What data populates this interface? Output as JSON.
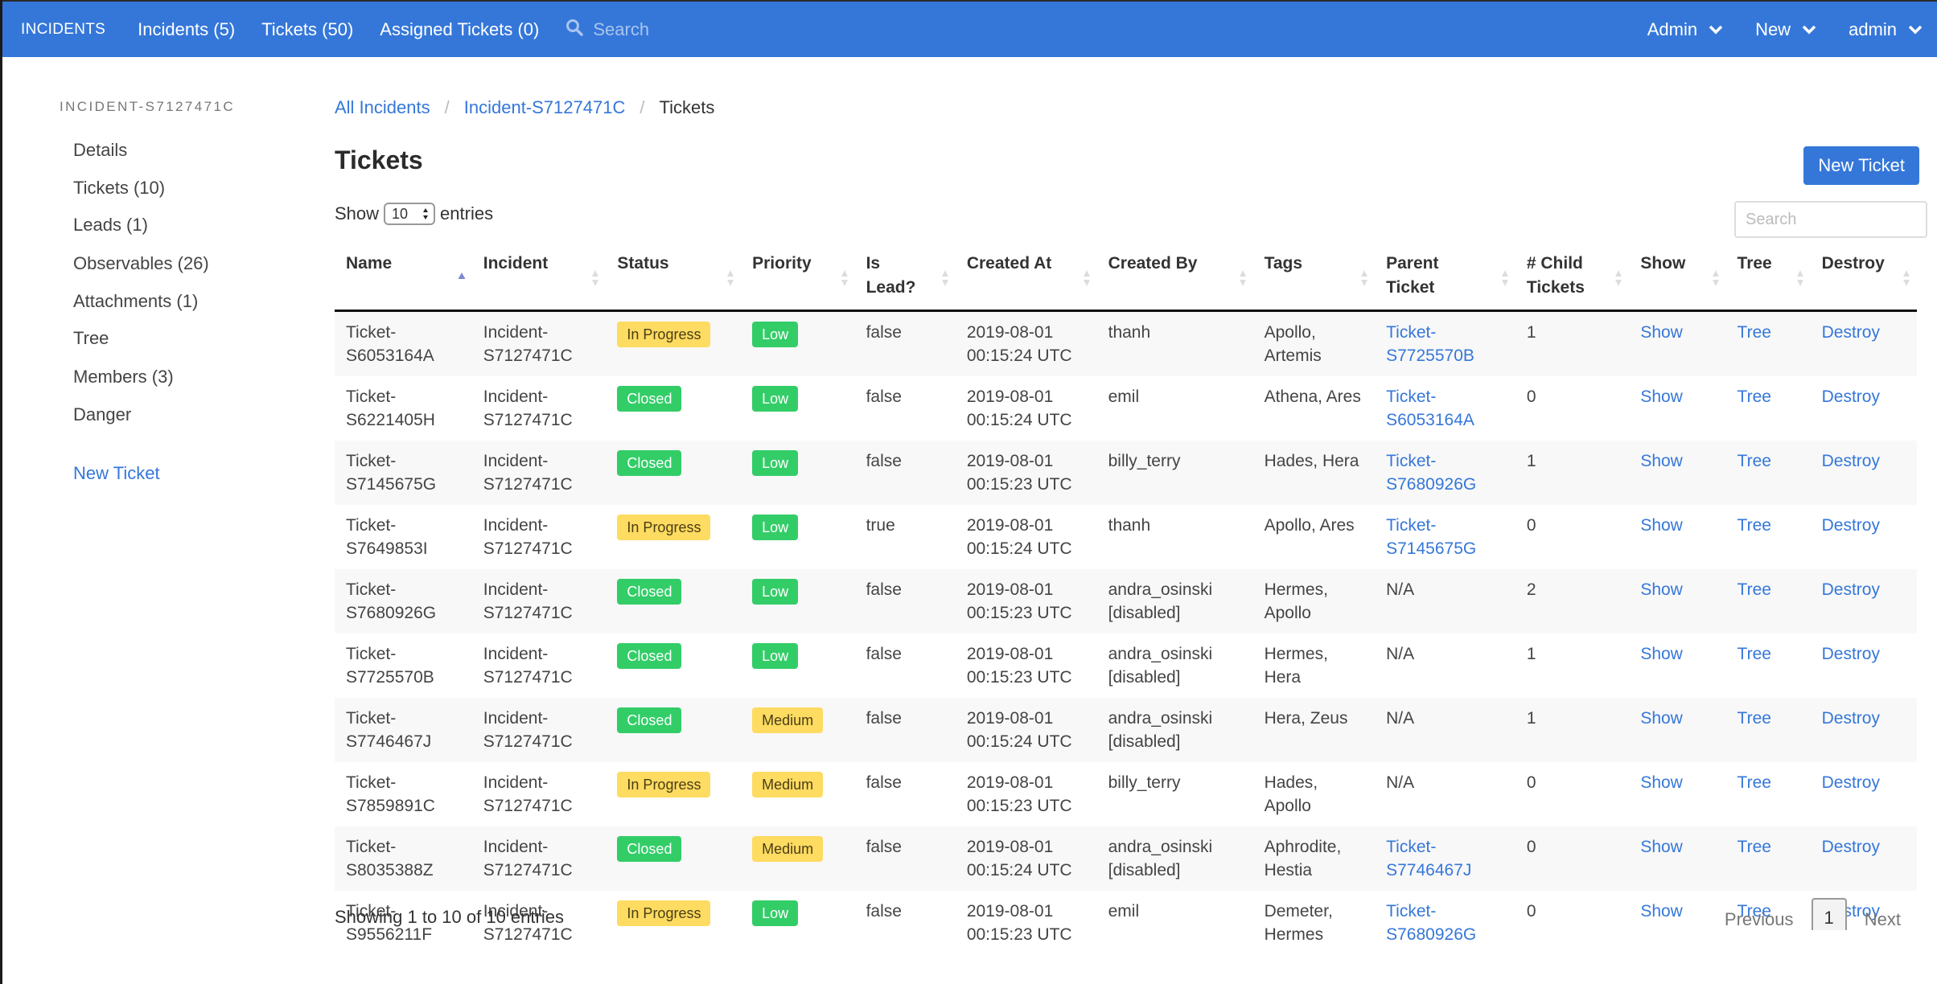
{
  "navbar": {
    "brand": "INCIDENTS",
    "links": [
      "Incidents (5)",
      "Tickets (50)",
      "Assigned Tickets (0)"
    ],
    "search_placeholder": "Search",
    "search_icon": "search-icon",
    "dropdowns": [
      "Admin",
      "New",
      "admin"
    ],
    "dropdown_icon": "chevron-down-icon",
    "color": "#3577d9"
  },
  "sidebar": {
    "heading": "INCIDENT-S7127471C",
    "items": [
      "Details",
      "Tickets (10)",
      "Leads (1)",
      "Observables (26)",
      "Attachments (1)",
      "Tree",
      "Members (3)",
      "Danger"
    ],
    "new_ticket_link": "New Ticket"
  },
  "breadcrumb": {
    "items": [
      "All Incidents",
      "Incident-S7127471C"
    ],
    "current": "Tickets",
    "separator": "/"
  },
  "page": {
    "title": "Tickets",
    "new_ticket_button": "New Ticket",
    "show_label": "Show",
    "entries_label": "entries",
    "page_length": "10",
    "search_placeholder": "Search"
  },
  "table": {
    "columns": [
      {
        "label": "Name",
        "sort": "asc"
      },
      {
        "label": "Incident",
        "sort": "none"
      },
      {
        "label": "Status",
        "sort": "none"
      },
      {
        "label": "Priority",
        "sort": "none"
      },
      {
        "label": "Is Lead?",
        "sort": "none"
      },
      {
        "label": "Created At",
        "sort": "none"
      },
      {
        "label": "Created By",
        "sort": "none"
      },
      {
        "label": "Tags",
        "sort": "none"
      },
      {
        "label": "Parent Ticket",
        "sort": "none"
      },
      {
        "label": "# Child Tickets",
        "sort": "none"
      },
      {
        "label": "Show",
        "sort": "none"
      },
      {
        "label": "Tree",
        "sort": "none"
      },
      {
        "label": "Destroy",
        "sort": "none"
      }
    ],
    "status_colors": {
      "In Progress": "#fedb61",
      "Closed": "#33cd68"
    },
    "priority_colors": {
      "Low": "#33cd68",
      "Medium": "#fedb61"
    },
    "rows": [
      {
        "name": "Ticket-S6053164A",
        "incident": "Incident-S7127471C",
        "status": "In Progress",
        "priority": "Low",
        "is_lead": "false",
        "created_at": "2019-08-01 00:15:24 UTC",
        "created_by": "thanh",
        "tags": "Apollo, Artemis",
        "parent": "Ticket-S7725570B",
        "children": "1",
        "show": "Show",
        "tree": "Tree",
        "destroy": "Destroy"
      },
      {
        "name": "Ticket-S6221405H",
        "incident": "Incident-S7127471C",
        "status": "Closed",
        "priority": "Low",
        "is_lead": "false",
        "created_at": "2019-08-01 00:15:24 UTC",
        "created_by": "emil",
        "tags": "Athena, Ares",
        "parent": "Ticket-S6053164A",
        "children": "0",
        "show": "Show",
        "tree": "Tree",
        "destroy": "Destroy"
      },
      {
        "name": "Ticket-S7145675G",
        "incident": "Incident-S7127471C",
        "status": "Closed",
        "priority": "Low",
        "is_lead": "false",
        "created_at": "2019-08-01 00:15:23 UTC",
        "created_by": "billy_terry",
        "tags": "Hades, Hera",
        "parent": "Ticket-S7680926G",
        "children": "1",
        "show": "Show",
        "tree": "Tree",
        "destroy": "Destroy"
      },
      {
        "name": "Ticket-S7649853I",
        "incident": "Incident-S7127471C",
        "status": "In Progress",
        "priority": "Low",
        "is_lead": "true",
        "created_at": "2019-08-01 00:15:24 UTC",
        "created_by": "thanh",
        "tags": "Apollo, Ares",
        "parent": "Ticket-S7145675G",
        "children": "0",
        "show": "Show",
        "tree": "Tree",
        "destroy": "Destroy"
      },
      {
        "name": "Ticket-S7680926G",
        "incident": "Incident-S7127471C",
        "status": "Closed",
        "priority": "Low",
        "is_lead": "false",
        "created_at": "2019-08-01 00:15:23 UTC",
        "created_by": "andra_osinski [disabled]",
        "tags": "Hermes, Apollo",
        "parent": "N/A",
        "children": "2",
        "show": "Show",
        "tree": "Tree",
        "destroy": "Destroy"
      },
      {
        "name": "Ticket-S7725570B",
        "incident": "Incident-S7127471C",
        "status": "Closed",
        "priority": "Low",
        "is_lead": "false",
        "created_at": "2019-08-01 00:15:23 UTC",
        "created_by": "andra_osinski [disabled]",
        "tags": "Hermes, Hera",
        "parent": "N/A",
        "children": "1",
        "show": "Show",
        "tree": "Tree",
        "destroy": "Destroy"
      },
      {
        "name": "Ticket-S7746467J",
        "incident": "Incident-S7127471C",
        "status": "Closed",
        "priority": "Medium",
        "is_lead": "false",
        "created_at": "2019-08-01 00:15:24 UTC",
        "created_by": "andra_osinski [disabled]",
        "tags": "Hera, Zeus",
        "parent": "N/A",
        "children": "1",
        "show": "Show",
        "tree": "Tree",
        "destroy": "Destroy"
      },
      {
        "name": "Ticket-S7859891C",
        "incident": "Incident-S7127471C",
        "status": "In Progress",
        "priority": "Medium",
        "is_lead": "false",
        "created_at": "2019-08-01 00:15:23 UTC",
        "created_by": "billy_terry",
        "tags": "Hades, Apollo",
        "parent": "N/A",
        "children": "0",
        "show": "Show",
        "tree": "Tree",
        "destroy": "Destroy"
      },
      {
        "name": "Ticket-S8035388Z",
        "incident": "Incident-S7127471C",
        "status": "Closed",
        "priority": "Medium",
        "is_lead": "false",
        "created_at": "2019-08-01 00:15:24 UTC",
        "created_by": "andra_osinski [disabled]",
        "tags": "Aphrodite, Hestia",
        "parent": "Ticket-S7746467J",
        "children": "0",
        "show": "Show",
        "tree": "Tree",
        "destroy": "Destroy"
      },
      {
        "name": "Ticket-S9556211F",
        "incident": "Incident-S7127471C",
        "status": "In Progress",
        "priority": "Low",
        "is_lead": "false",
        "created_at": "2019-08-01 00:15:23 UTC",
        "created_by": "emil",
        "tags": "Demeter, Hermes",
        "parent": "Ticket-S7680926G",
        "children": "0",
        "show": "Show",
        "tree": "Tree",
        "destroy": "Destroy"
      }
    ]
  },
  "footer": {
    "info": "Showing 1 to 10 of 10 entries",
    "previous": "Previous",
    "current_page": "1",
    "next": "Next"
  }
}
